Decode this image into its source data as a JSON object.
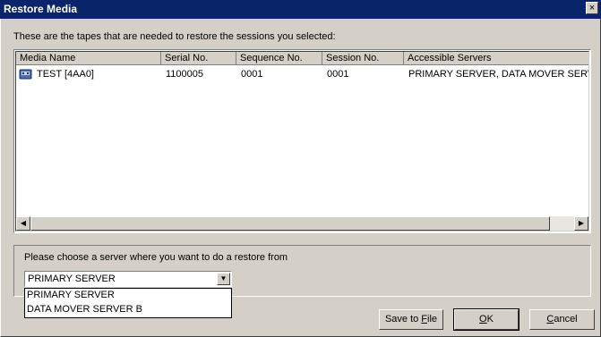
{
  "window": {
    "title": "Restore Media",
    "close_glyph": "×"
  },
  "intro_text": "These are the tapes that are needed to restore the sessions you selected:",
  "table": {
    "columns": [
      "Media Name",
      "Serial No.",
      "Sequence No.",
      "Session No.",
      "Accessible Servers"
    ],
    "rows": [
      {
        "media_name": "TEST [4AA0]",
        "serial": "1100005",
        "sequence": "0001",
        "session": "0001",
        "servers": "PRIMARY SERVER, DATA MOVER SERV",
        "icon": "tape-icon"
      }
    ]
  },
  "scrollbar": {
    "left_glyph": "◀",
    "right_glyph": "▶"
  },
  "server_choice": {
    "label": "Please choose a server where you want to do a restore from",
    "selected": "PRIMARY SERVER",
    "arrow_glyph": "▼",
    "options": [
      "PRIMARY SERVER",
      "DATA MOVER SERVER B"
    ]
  },
  "buttons": {
    "save_prefix": "Save to ",
    "save_underlined": "F",
    "save_suffix": "ile",
    "ok_underlined": "O",
    "ok_suffix": "K",
    "cancel_underlined": "C",
    "cancel_suffix": "ancel"
  },
  "colors": {
    "titlebar": "#0a246a",
    "dialog_bg": "#d4d0c8"
  }
}
